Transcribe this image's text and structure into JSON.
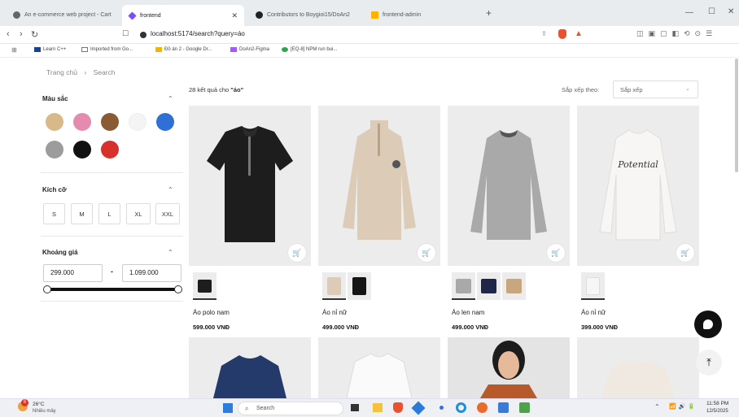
{
  "browser": {
    "tabs": [
      {
        "title": "An e-commerce web project - Cart",
        "active": false
      },
      {
        "title": "frontend",
        "active": true
      },
      {
        "title": "Contributors to Boygioi15/DoAn2",
        "active": false
      },
      {
        "title": "frontend-admin",
        "active": false
      }
    ],
    "new_tab": "+",
    "url": "localhost:5174/search?query=áo",
    "bookmarks": [
      "Learn C++",
      "Imported from Go...",
      "Đồ án 2 - Google Dr...",
      "DoAn2-Figma",
      "[EQ-8] NPM run bui..."
    ]
  },
  "breadcrumb": {
    "home": "Trang chủ",
    "sep": "›",
    "current": "Search"
  },
  "filters": {
    "color": {
      "title": "Màu sắc",
      "swatches": [
        "#d7b98a",
        "#e68bb0",
        "#8a5a35",
        "#f4f4f4",
        "#2f6fd6",
        "#9c9c9c",
        "#111111",
        "#d8302b"
      ]
    },
    "size": {
      "title": "Kích cỡ",
      "options": [
        "S",
        "M",
        "L",
        "XL",
        "XXL"
      ]
    },
    "price": {
      "title": "Khoảng giá",
      "min": "299.000",
      "dash": "-",
      "max": "1.099.000"
    }
  },
  "results": {
    "prefix": "28 kết quả cho ",
    "query": "\"áo\""
  },
  "sort": {
    "label": "Sắp xếp theo:",
    "value": "Sắp xếp"
  },
  "products": [
    {
      "name": "Áo polo nam",
      "price": "599.000 VNĐ",
      "color": "#1d1d1d"
    },
    {
      "name": "Áo nỉ nữ",
      "price": "499.000 VNĐ",
      "color": "#dccbb6"
    },
    {
      "name": "Áo len nam",
      "price": "499.000 VNĐ",
      "color": "#a9a9a9"
    },
    {
      "name": "Áo nỉ nữ",
      "price": "399.000 VNĐ",
      "color": "#f3f1ee",
      "print": "Potential"
    }
  ],
  "taskbar": {
    "weather_temp": "26°C",
    "weather_desc": "Nhiều mây",
    "badge": "6",
    "search": "Search",
    "time": "11:58 PM",
    "date": "12/5/2025"
  }
}
